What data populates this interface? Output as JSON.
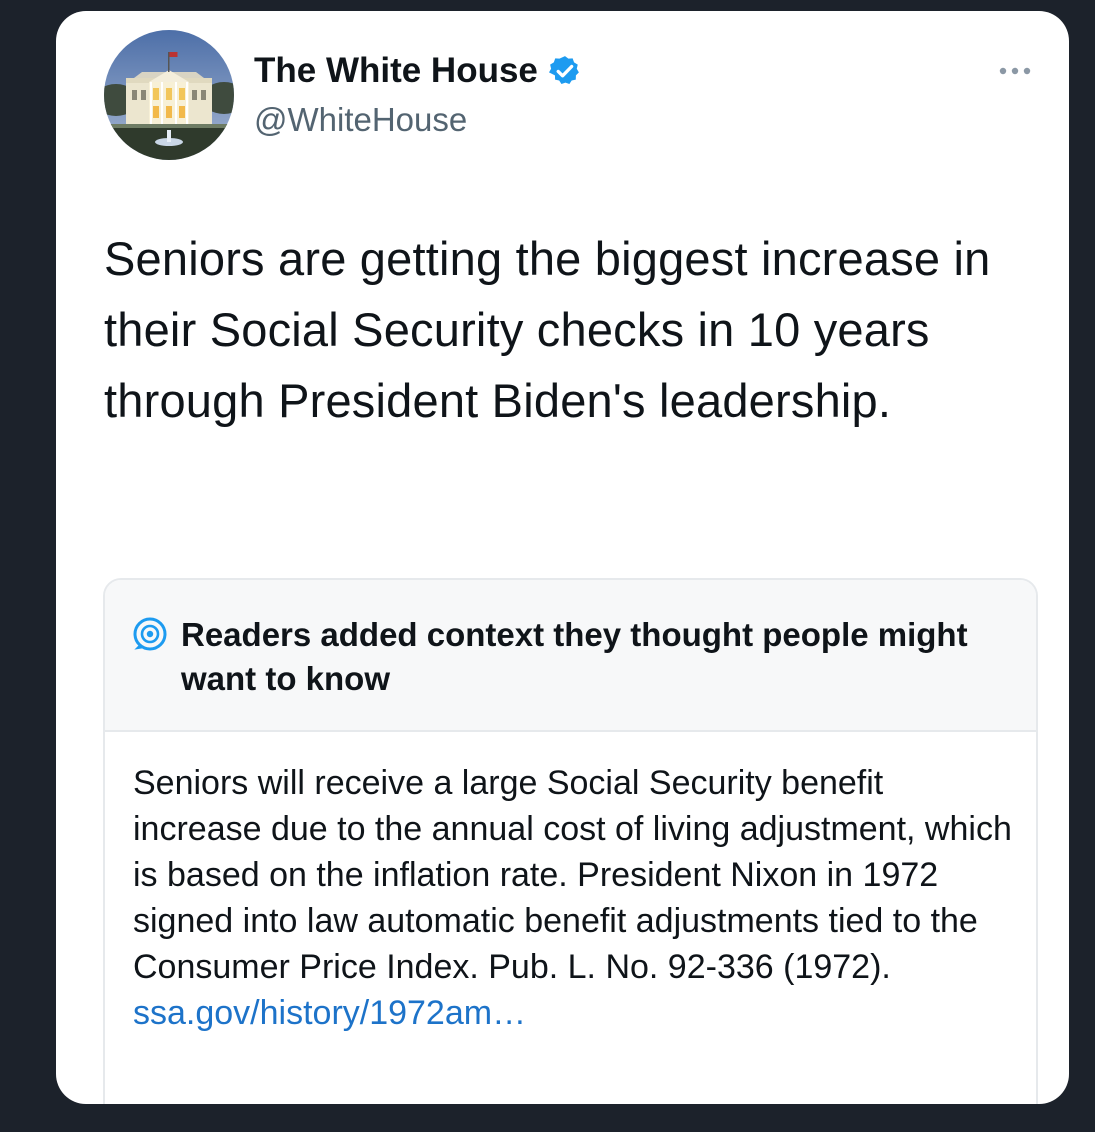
{
  "tweet": {
    "author": {
      "name": "The White House",
      "handle": "@WhiteHouse",
      "verified": true,
      "avatar_icon": "white-house-photo"
    },
    "text": "Seniors are getting the biggest increase in their Social Security checks in 10 years through President Biden's leadership.",
    "more_icon": "more-options-icon"
  },
  "note": {
    "icon": "community-notes-icon",
    "title": "Readers added context they thought people might want to know",
    "body": "Seniors will receive a large Social Security benefit increase due to the annual cost of living adjustment, which is based on the inflation rate. President Nixon in 1972 signed into law automatic benefit adjustments tied to the Consumer Price Index. Pub. L. No. 92-336 (1972).",
    "link": "ssa.gov/history/1972am…"
  },
  "colors": {
    "background": "#1c222b",
    "card": "#ffffff",
    "verified_badge": "#1d9bf0",
    "link": "#1d73c9",
    "secondary_text": "#536471"
  }
}
